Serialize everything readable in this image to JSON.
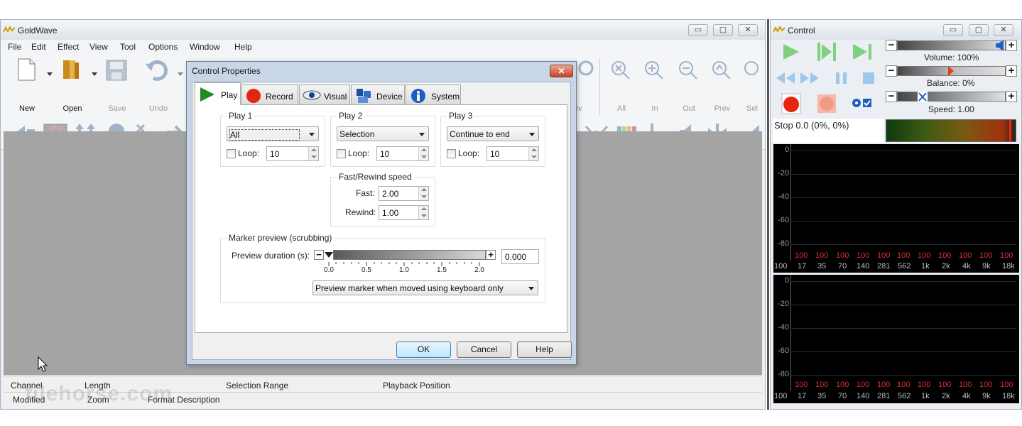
{
  "main_window": {
    "title": "GoldWave",
    "menu": [
      "File",
      "Edit",
      "Effect",
      "View",
      "Tool",
      "Options",
      "Window",
      "Help"
    ],
    "toolbar": [
      {
        "label": "New",
        "icon": "new-file-icon",
        "enabled": true
      },
      {
        "label": "Open",
        "icon": "open-folder-icon",
        "enabled": true
      },
      {
        "label": "Save",
        "icon": "save-disk-icon",
        "enabled": false
      },
      {
        "label": "Undo",
        "icon": "undo-icon",
        "enabled": false
      }
    ],
    "toolbar_right": [
      {
        "label": "rev",
        "icon": "zoom-previous-icon"
      },
      {
        "label": "All",
        "icon": "zoom-all-icon"
      },
      {
        "label": "In",
        "icon": "zoom-in-icon"
      },
      {
        "label": "Out",
        "icon": "zoom-out-icon"
      },
      {
        "label": "Prev",
        "icon": "zoom-previous-icon"
      },
      {
        "label": "Sel",
        "icon": "zoom-selection-icon"
      }
    ],
    "status": {
      "row1": [
        "Channel",
        "Length",
        "Selection Range",
        "Playback Position"
      ],
      "row2": [
        "Modified",
        "Zoom",
        "Format Description"
      ]
    },
    "watermark": "filehorse.com"
  },
  "dialog": {
    "title": "Control Properties",
    "close": "✕",
    "tabs": [
      {
        "label": "Play",
        "icon": "play-triangle-icon",
        "active": true
      },
      {
        "label": "Record",
        "icon": "record-dot-icon"
      },
      {
        "label": "Visual",
        "icon": "eye-icon"
      },
      {
        "label": "Device",
        "icon": "device-icon"
      },
      {
        "label": "System",
        "icon": "info-icon"
      }
    ],
    "play1": {
      "label": "Play 1",
      "value": "All",
      "loop_label": "Loop:",
      "loop_value": "10"
    },
    "play2": {
      "label": "Play 2",
      "value": "Selection",
      "loop_label": "Loop:",
      "loop_value": "10"
    },
    "play3": {
      "label": "Play 3",
      "value": "Continue to end",
      "loop_label": "Loop:",
      "loop_value": "10"
    },
    "fast_rewind": {
      "label": "Fast/Rewind speed",
      "fast_label": "Fast:",
      "fast_value": "2.00",
      "rewind_label": "Rewind:",
      "rewind_value": "1.00"
    },
    "marker": {
      "label": "Marker preview (scrubbing)",
      "duration_label": "Preview duration (s):",
      "duration_value": "0.000",
      "scale": [
        "0.0",
        "0.5",
        "1.0",
        "1.5",
        "2.0"
      ],
      "mode": "Preview marker when moved using keyboard only"
    },
    "buttons": {
      "ok": "OK",
      "cancel": "Cancel",
      "help": "Help"
    }
  },
  "control_window": {
    "title": "Control",
    "volume": "Volume: 100%",
    "balance": "Balance: 0%",
    "speed": "Speed: 1.00",
    "status": "Stop 0.0 (0%, 0%)",
    "spectrum": {
      "y_ticks": [
        "0",
        "-20",
        "-40",
        "-60",
        "-80"
      ],
      "y_ticks_lower": [
        "0",
        "-20",
        "-40",
        "-60",
        "-80"
      ],
      "peak_values": [
        "100",
        "100",
        "100",
        "100",
        "100",
        "100",
        "100",
        "100",
        "100",
        "100",
        "100"
      ],
      "freqs": [
        "100",
        "17",
        "35",
        "70",
        "140",
        "281",
        "562",
        "1k",
        "2k",
        "4k",
        "9k",
        "18k"
      ]
    }
  }
}
